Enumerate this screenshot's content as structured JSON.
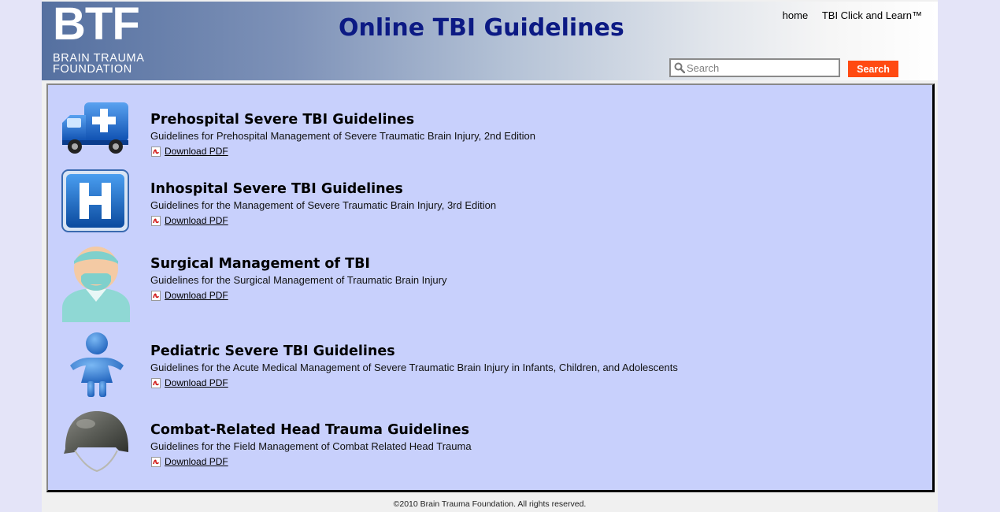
{
  "header": {
    "logo_text": "BTF",
    "logo_line1": "BRAIN TRAUMA",
    "logo_line2": "FOUNDATION",
    "title": "Online TBI Guidelines",
    "nav": {
      "home": "home",
      "tbi_click_learn": "TBI Click and Learn™"
    },
    "search": {
      "placeholder": "Search",
      "button_label": "Search"
    },
    "colors": {
      "title": "#0c1a84",
      "search_button": "#ff4a12"
    }
  },
  "guidelines": [
    {
      "icon": "ambulance-icon",
      "title": "Prehospital Severe TBI Guidelines",
      "description": "Guidelines for Prehospital Management of Severe Traumatic Brain Injury, 2nd Edition",
      "download_label": "Download PDF"
    },
    {
      "icon": "hospital-icon",
      "title": "Inhospital Severe TBI Guidelines",
      "description": "Guidelines for the Management of Severe Traumatic Brain Injury, 3rd Edition",
      "download_label": "Download PDF"
    },
    {
      "icon": "surgeon-icon",
      "title": "Surgical Management of TBI",
      "description": "Guidelines for the Surgical Management of Traumatic Brain Injury",
      "download_label": "Download PDF"
    },
    {
      "icon": "child-icon",
      "title": "Pediatric Severe TBI Guidelines",
      "description": "Guidelines for the Acute Medical Management of Severe Traumatic Brain Injury in Infants, Children, and Adolescents",
      "download_label": "Download PDF"
    },
    {
      "icon": "helmet-icon",
      "title": "Combat-Related Head Trauma Guidelines",
      "description": "Guidelines for the Field Management of Combat Related Head Trauma",
      "download_label": "Download PDF"
    }
  ],
  "footer": {
    "copyright": "©2010 Brain Trauma Foundation. All rights reserved."
  }
}
